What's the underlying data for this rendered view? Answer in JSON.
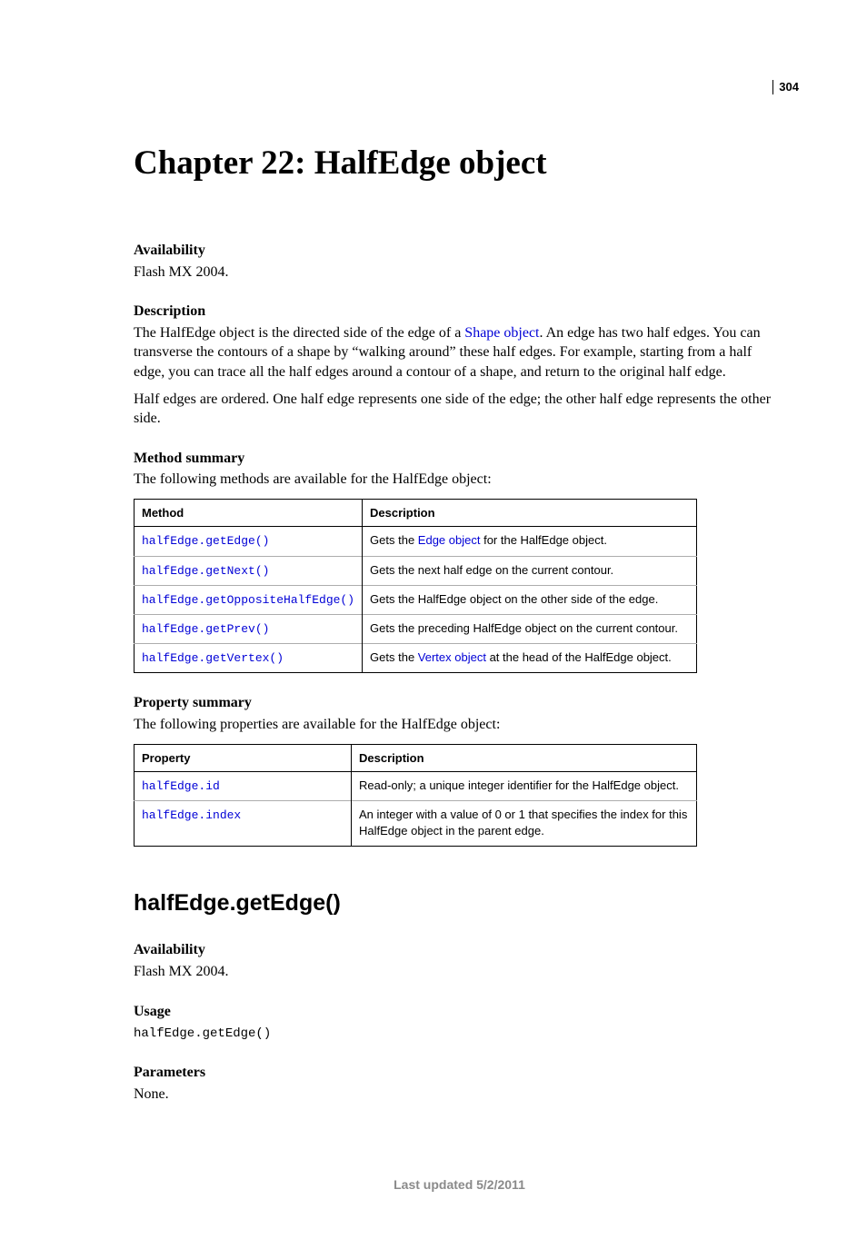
{
  "page_number": "304",
  "chapter_title": "Chapter 22: HalfEdge object",
  "availability_label": "Availability",
  "availability_text": "Flash MX 2004.",
  "description_label": "Description",
  "description_p1_pre": "The HalfEdge object is the directed side of the edge of a ",
  "description_p1_link": "Shape object",
  "description_p1_post": ". An edge has two half edges. You can transverse the contours of a shape by “walking around” these half edges. For example, starting from a half edge, you can trace all the half edges around a contour of a shape, and return to the original half edge.",
  "description_p2": "Half edges are ordered. One half edge represents one side of the edge; the other half edge represents the other side.",
  "method_summary_label": "Method summary",
  "method_summary_intro": "The following methods are available for the HalfEdge object:",
  "table_headers": {
    "method": "Method",
    "property": "Property",
    "description": "Description"
  },
  "methods": [
    {
      "name": "halfEdge.getEdge()",
      "desc_pre": "Gets the ",
      "desc_link": "Edge object",
      "desc_post": " for the HalfEdge object."
    },
    {
      "name": "halfEdge.getNext()",
      "desc_pre": "Gets the next half edge on the current contour.",
      "desc_link": "",
      "desc_post": ""
    },
    {
      "name": "halfEdge.getOppositeHalfEdge()",
      "desc_pre": "Gets the HalfEdge object on the other side of the edge.",
      "desc_link": "",
      "desc_post": ""
    },
    {
      "name": "halfEdge.getPrev()",
      "desc_pre": "Gets the preceding HalfEdge object on the current contour.",
      "desc_link": "",
      "desc_post": ""
    },
    {
      "name": "halfEdge.getVertex()",
      "desc_pre": "Gets the ",
      "desc_link": "Vertex object",
      "desc_post": " at the head of the HalfEdge object."
    }
  ],
  "property_summary_label": "Property summary",
  "property_summary_intro": "The following properties are available for the HalfEdge object:",
  "properties": [
    {
      "name": "halfEdge.id",
      "desc": "Read-only; a unique integer identifier for the HalfEdge object."
    },
    {
      "name": "halfEdge.index",
      "desc": "An integer with a value of 0 or 1 that specifies the index for this HalfEdge object in the parent edge."
    }
  ],
  "section": {
    "title": "halfEdge.getEdge()",
    "availability_label": "Availability",
    "availability_text": "Flash MX 2004.",
    "usage_label": "Usage",
    "usage_code": "halfEdge.getEdge()",
    "parameters_label": "Parameters",
    "parameters_text": "None."
  },
  "footer": "Last updated 5/2/2011"
}
